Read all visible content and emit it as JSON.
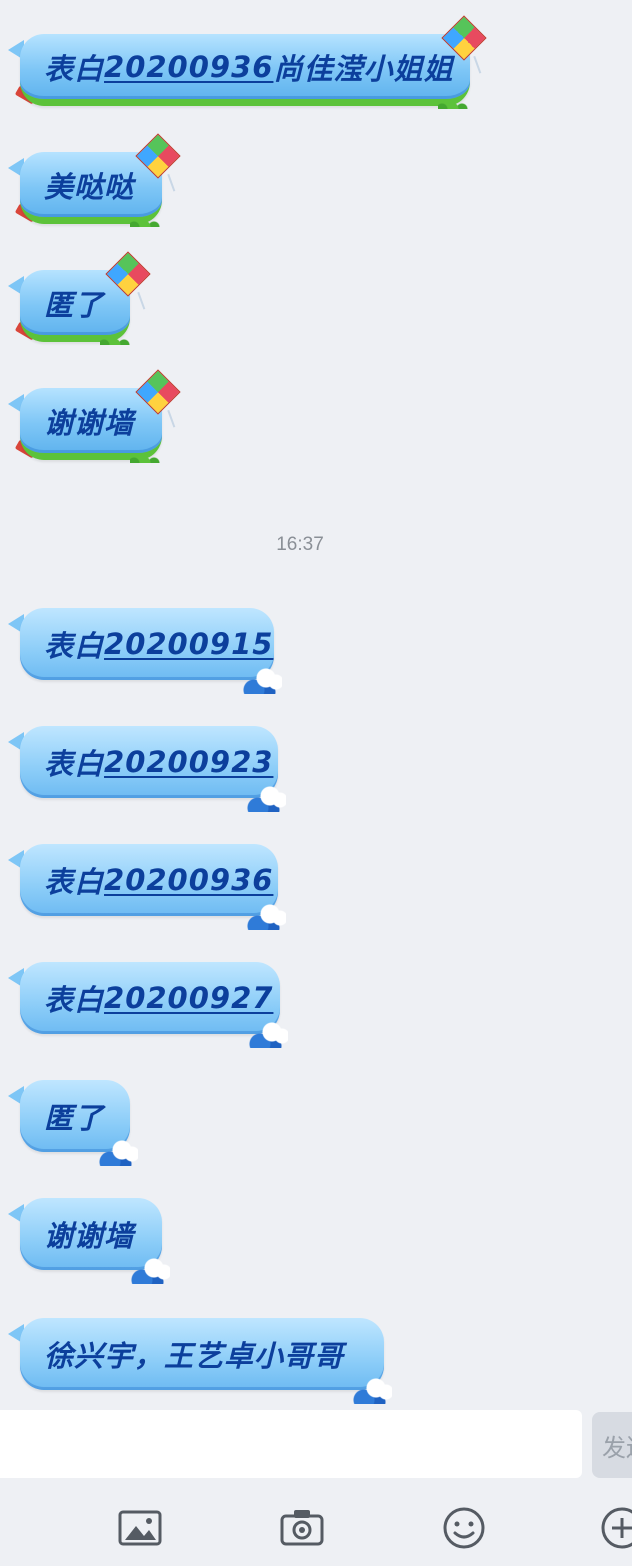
{
  "messages_before": [
    {
      "prefix": "表白",
      "number": "20200936",
      "suffix": "尚佳滢小姐姐",
      "style": "kite"
    },
    {
      "prefix": "美哒哒",
      "number": "",
      "suffix": "",
      "style": "kite"
    },
    {
      "prefix": "匿了",
      "number": "",
      "suffix": "",
      "style": "kite"
    },
    {
      "prefix": "谢谢墙",
      "number": "",
      "suffix": "",
      "style": "kite"
    }
  ],
  "timestamp": "16:37",
  "messages_after": [
    {
      "prefix": "表白",
      "number": "20200915",
      "suffix": "",
      "style": "wave"
    },
    {
      "prefix": "表白",
      "number": "20200923",
      "suffix": "",
      "style": "wave"
    },
    {
      "prefix": "表白",
      "number": "20200936",
      "suffix": "",
      "style": "wave"
    },
    {
      "prefix": "表白",
      "number": "20200927",
      "suffix": "",
      "style": "wave"
    },
    {
      "prefix": "匿了",
      "number": "",
      "suffix": "",
      "style": "wave"
    },
    {
      "prefix": "谢谢墙",
      "number": "",
      "suffix": "",
      "style": "wave"
    },
    {
      "prefix": "徐兴宇，王艺卓小哥哥",
      "number": "",
      "suffix": "",
      "style": "wave"
    }
  ],
  "input": {
    "value": "",
    "placeholder": ""
  },
  "send_label": "发送",
  "toolbar": [
    {
      "icon": "image-icon"
    },
    {
      "icon": "camera-icon"
    },
    {
      "icon": "emoji-icon"
    },
    {
      "icon": "plus-icon"
    }
  ],
  "colors": {
    "bubble_text": "#0c3f9c",
    "bubble_blue": "#7ec6f6",
    "grass_green": "#5cc23a",
    "background": "#eef0f4"
  }
}
